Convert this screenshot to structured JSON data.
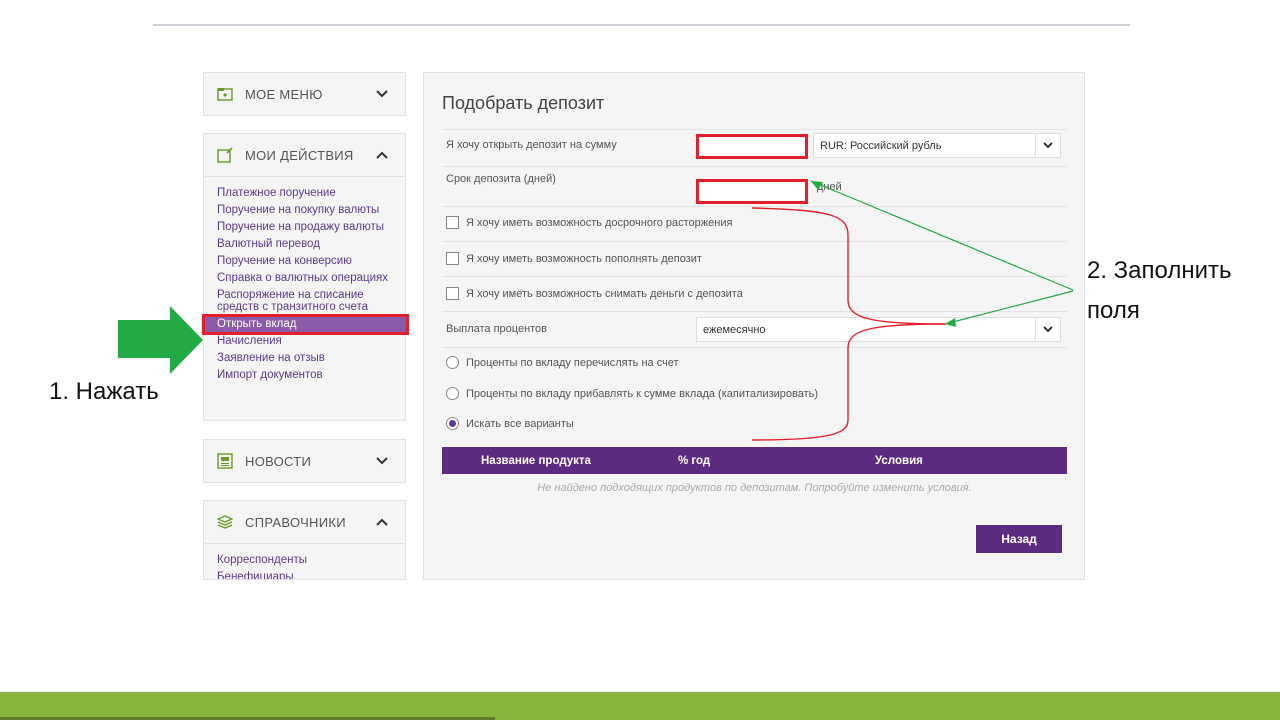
{
  "sidebar": {
    "my_menu": {
      "label": "МОЕ МЕНЮ",
      "icon": "menu-icon"
    },
    "my_actions": {
      "label": "МОИ ДЕЙСТВИЯ",
      "icon": "edit-icon",
      "items": [
        "Платежное поручение",
        "Поручение на покупку валюты",
        "Поручение на продажу валюты",
        "Валютный перевод",
        "Поручение на конверсию",
        "Справка о валютных операциях",
        "Распоряжение на списание средств с транзитного счета",
        "Открыть вклад",
        "Начисления",
        "Заявление на отзыв",
        "Импорт документов"
      ],
      "active_item": "Открыть вклад"
    },
    "news": {
      "label": "НОВОСТИ",
      "icon": "news-icon"
    },
    "references": {
      "label": "СПРАВОЧНИКИ",
      "icon": "layers-icon",
      "items": [
        "Корреспонденты",
        "Бенефициары"
      ]
    }
  },
  "main": {
    "title": "Подобрать депозит",
    "amount_label": "Я хочу открыть депозит на сумму",
    "amount_value": "",
    "currency_selected": "RUR: Российский рубль",
    "term_label": "Срок депозита (дней)",
    "term_value": "",
    "term_unit": "дней",
    "checkboxes": [
      "Я хочу иметь возможность досрочного расторжения",
      "Я хочу иметь возможность пополнять депозит",
      "Я хочу иметь возможность снимать деньги с депозита"
    ],
    "interest_label": "Выплата процентов",
    "interest_selected": "ежемесячно",
    "radios": [
      {
        "label": "Проценты по вкладу перечислять на счет",
        "checked": false
      },
      {
        "label": "Проценты по вкладу прибавлять к сумме вклада (капитализировать)",
        "checked": false
      },
      {
        "label": "Искать все варианты",
        "checked": true
      }
    ],
    "table_headers": [
      "Название продукта",
      "% год",
      "Условия"
    ],
    "empty_message": "Не найдено подходящих продуктов по депозитам. Попробуйте изменить условия.",
    "back_button": "Назад"
  },
  "annotations": {
    "step1": "1. Нажать",
    "step2_line1": "2. Заполнить",
    "step2_line2": "поля"
  },
  "colors": {
    "brand_purple": "#5d2a82",
    "highlight_red": "#e0202a",
    "arrow_green": "#22aa44",
    "bottom_bar": "#8ab53c"
  }
}
